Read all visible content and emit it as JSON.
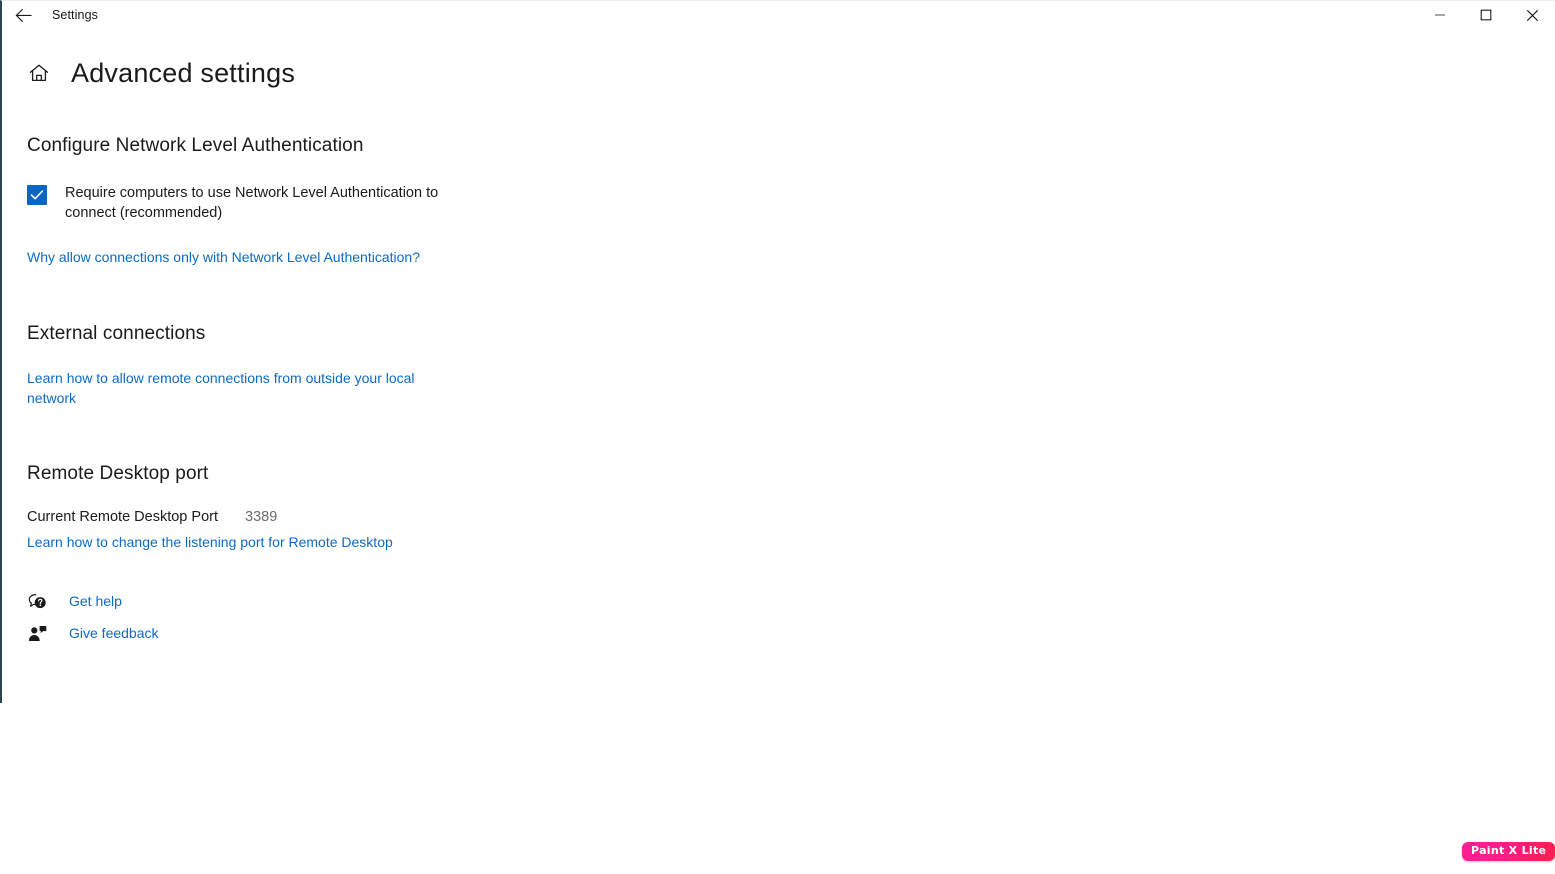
{
  "window": {
    "titlebar_title": "Settings",
    "back_icon": "back-arrow-icon",
    "minimize_label": "Minimize",
    "maximize_label": "Maximize",
    "close_label": "Close"
  },
  "header": {
    "home_icon": "home-icon",
    "title": "Advanced settings"
  },
  "sections": {
    "nla": {
      "title": "Configure Network Level Authentication",
      "checkbox_label": "Require computers to use Network Level Authentication to connect (recommended)",
      "checkbox_checked": true,
      "link": "Why allow connections only with Network Level Authentication?"
    },
    "external": {
      "title": "External connections",
      "link": "Learn how to allow remote connections from outside your local network"
    },
    "port": {
      "title": "Remote Desktop port",
      "label": "Current Remote Desktop Port",
      "value": "3389",
      "link": "Learn how to change the listening port for Remote Desktop"
    }
  },
  "help": {
    "get_help": {
      "icon": "question-bubble-icon",
      "label": "Get help"
    },
    "give_feedback": {
      "icon": "feedback-person-icon",
      "label": "Give feedback"
    }
  },
  "watermark": {
    "text": "Paint X Lite"
  },
  "colors": {
    "accent": "#0a64c2",
    "link": "#0d6bc4",
    "text": "#1b1b1b",
    "muted": "#6d6d6d",
    "window_border": "#2b4450"
  }
}
